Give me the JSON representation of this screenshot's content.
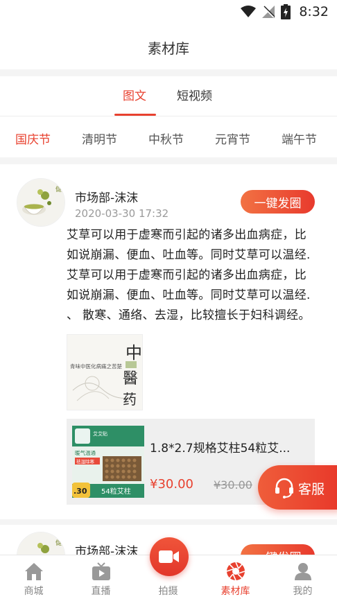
{
  "status_bar": {
    "time": "8:32"
  },
  "page_title": "素材库",
  "main_tabs": [
    {
      "label": "图文",
      "active": true
    },
    {
      "label": "短视频",
      "active": false
    }
  ],
  "festivals": [
    {
      "label": "国庆节",
      "active": true
    },
    {
      "label": "清明节",
      "active": false
    },
    {
      "label": "中秋节",
      "active": false
    },
    {
      "label": "元宵节",
      "active": false
    },
    {
      "label": "端午节",
      "active": false
    }
  ],
  "posts": [
    {
      "author": "市场部-沫沫",
      "timestamp": "2020-03-30 17:32",
      "share_label": "一键发圈",
      "avatar_text": "健康养生",
      "body_lines": [
        "艾草可以用于虚寒而引起的诸多出血病症，比",
        "如说崩漏、便血、吐血等。同时艾草可以温经.",
        "艾草可以用于虚寒而引起的诸多出血病症，比",
        "如说崩漏、便血、吐血等。同时艾草可以温经.",
        "、 散寒、通络、去湿，比较擅长于妇科调经。"
      ],
      "image_text": {
        "headline": "青味中医化病痛之苦楚",
        "big_chars": [
          "中",
          "醫",
          "药"
        ]
      },
      "product": {
        "name": "1.8*2.7规格艾柱54粒艾...",
        "price": "¥30.00",
        "old_price": "¥30.00",
        "thumb_text": {
          "brand": "艾艾贴",
          "line1": "暖气温通",
          "line2": "祛湿除寒",
          "badge": ".30",
          "caption": "54粒艾柱"
        }
      }
    },
    {
      "author": "市场部-沫沫",
      "share_label": "一键发圈",
      "avatar_text": "健康养生"
    }
  ],
  "service": {
    "label": "客服"
  },
  "bottom_nav": [
    {
      "label": "商城",
      "icon": "home-icon",
      "active": false
    },
    {
      "label": "直播",
      "icon": "tv-icon",
      "active": false
    },
    {
      "label": "拍摄",
      "icon": "camera-icon",
      "active": false
    },
    {
      "label": "素材库",
      "icon": "aperture-icon",
      "active": true
    },
    {
      "label": "我的",
      "icon": "user-icon",
      "active": false
    }
  ],
  "colors": {
    "accent": "#e8412f",
    "muted": "#888888",
    "background_gap": "#f4f4f4"
  }
}
